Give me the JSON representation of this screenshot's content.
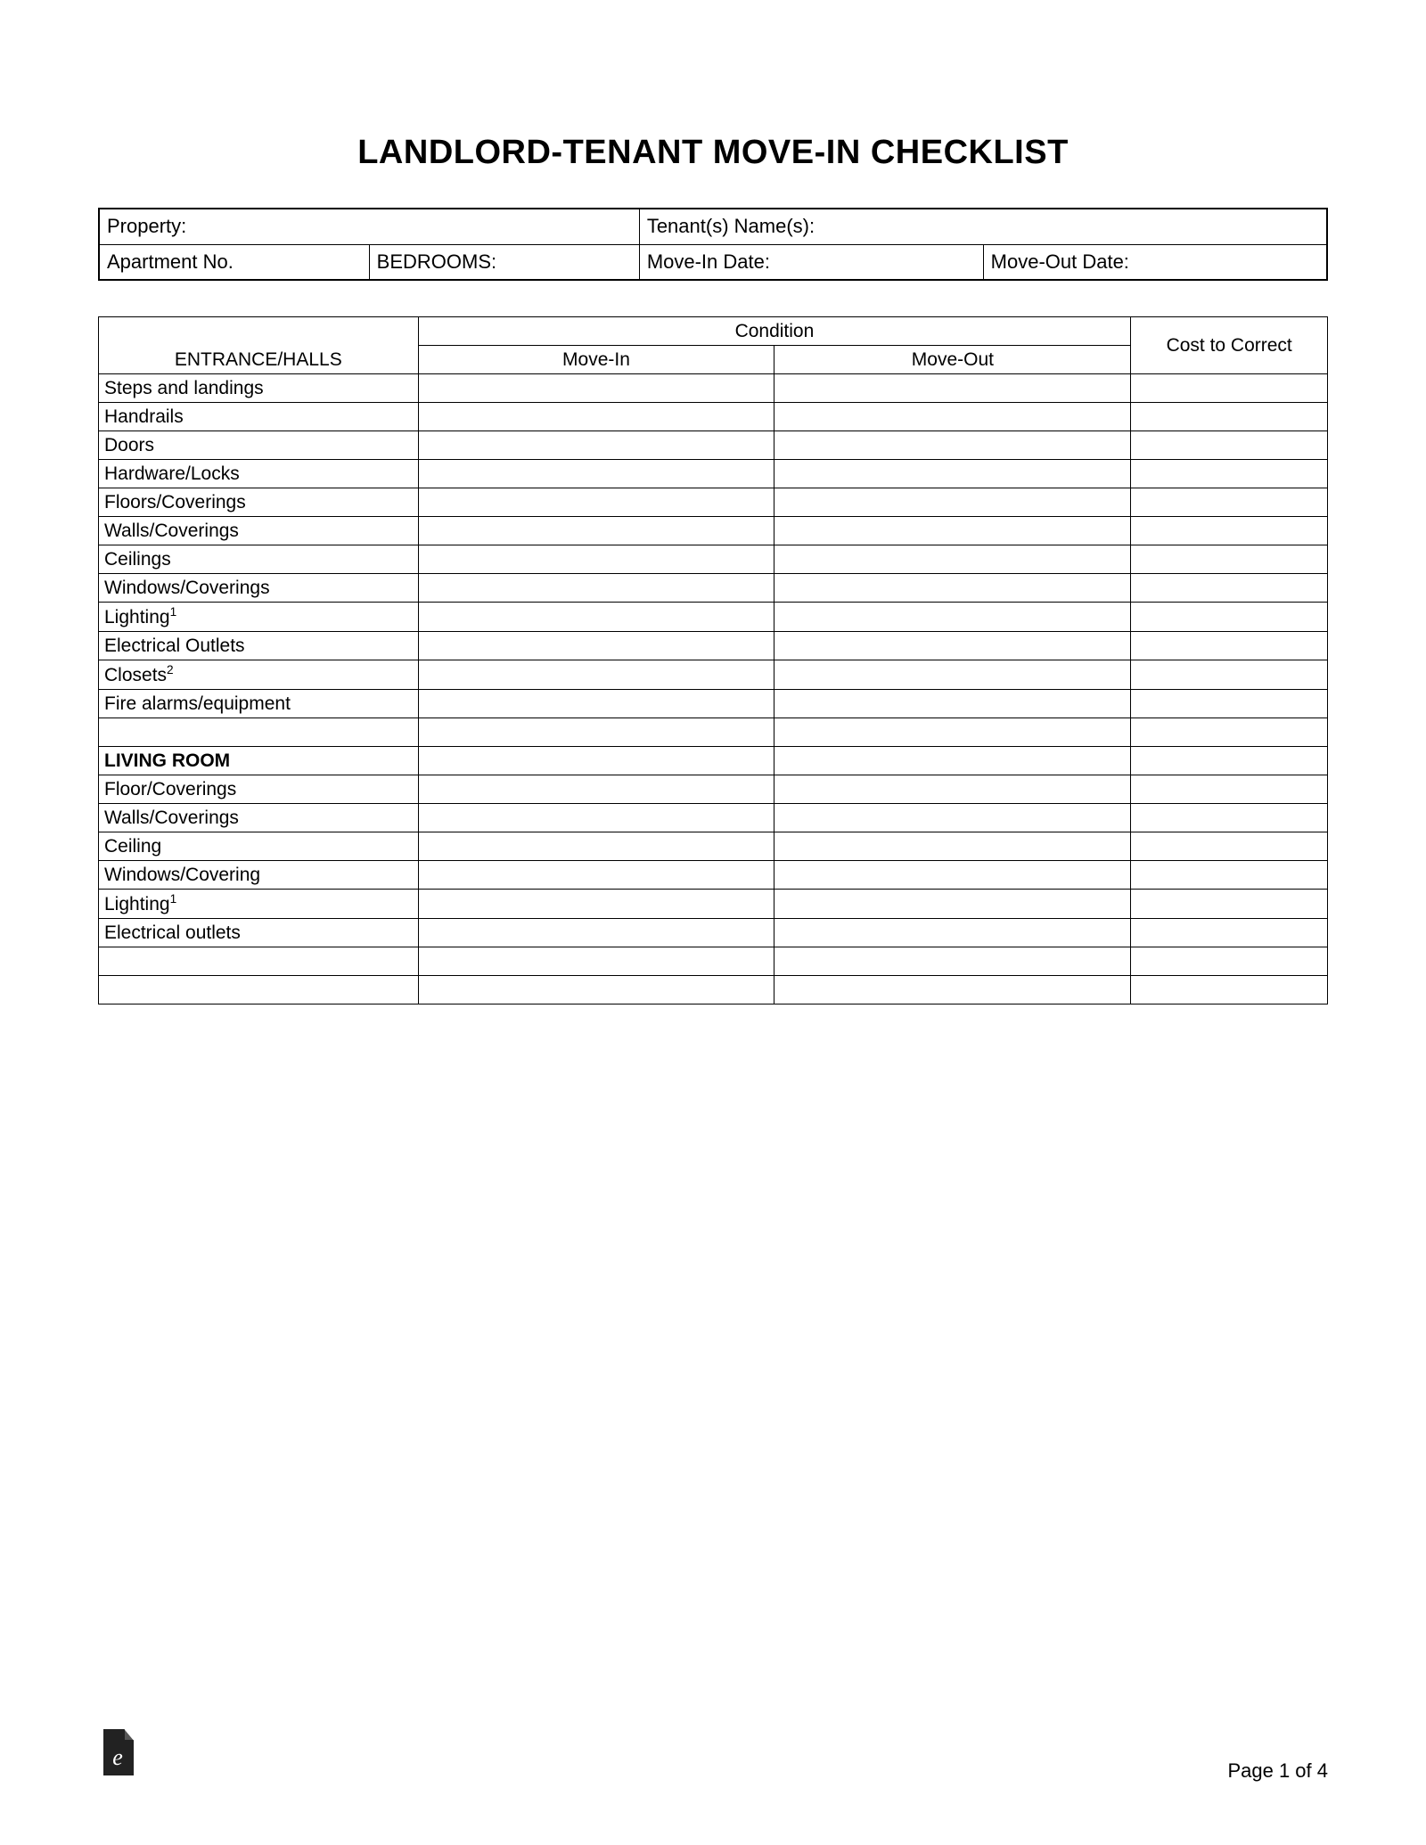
{
  "title": "LANDLORD-TENANT MOVE-IN CHECKLIST",
  "header": {
    "property": "Property:",
    "tenants": "Tenant(s) Name(s):",
    "apartment": "Apartment No.",
    "bedrooms": "BEDROOMS:",
    "movein": "Move-In Date:",
    "moveout": "Move-Out Date:"
  },
  "columns": {
    "condition": "Condition",
    "movein": "Move-In",
    "moveout": "Move-Out",
    "cost": "Cost to Correct"
  },
  "sections": [
    {
      "name": "ENTRANCE/HALLS",
      "items": [
        {
          "label": "Steps and landings",
          "sup": ""
        },
        {
          "label": "Handrails",
          "sup": ""
        },
        {
          "label": "Doors",
          "sup": ""
        },
        {
          "label": "Hardware/Locks",
          "sup": ""
        },
        {
          "label": "Floors/Coverings",
          "sup": ""
        },
        {
          "label": "Walls/Coverings",
          "sup": ""
        },
        {
          "label": "Ceilings",
          "sup": ""
        },
        {
          "label": "Windows/Coverings",
          "sup": ""
        },
        {
          "label": "Lighting",
          "sup": "1"
        },
        {
          "label": "Electrical Outlets",
          "sup": ""
        },
        {
          "label": "Closets",
          "sup": "2"
        },
        {
          "label": "Fire alarms/equipment",
          "sup": ""
        }
      ],
      "trailingBlanks": 1
    },
    {
      "name": "LIVING ROOM",
      "items": [
        {
          "label": "Floor/Coverings",
          "sup": ""
        },
        {
          "label": "Walls/Coverings",
          "sup": ""
        },
        {
          "label": "Ceiling",
          "sup": ""
        },
        {
          "label": "Windows/Covering",
          "sup": ""
        },
        {
          "label": "Lighting",
          "sup": "1"
        },
        {
          "label": "Electrical outlets",
          "sup": ""
        }
      ],
      "trailingBlanks": 2
    }
  ],
  "footer": {
    "page": "Page 1 of 4"
  }
}
